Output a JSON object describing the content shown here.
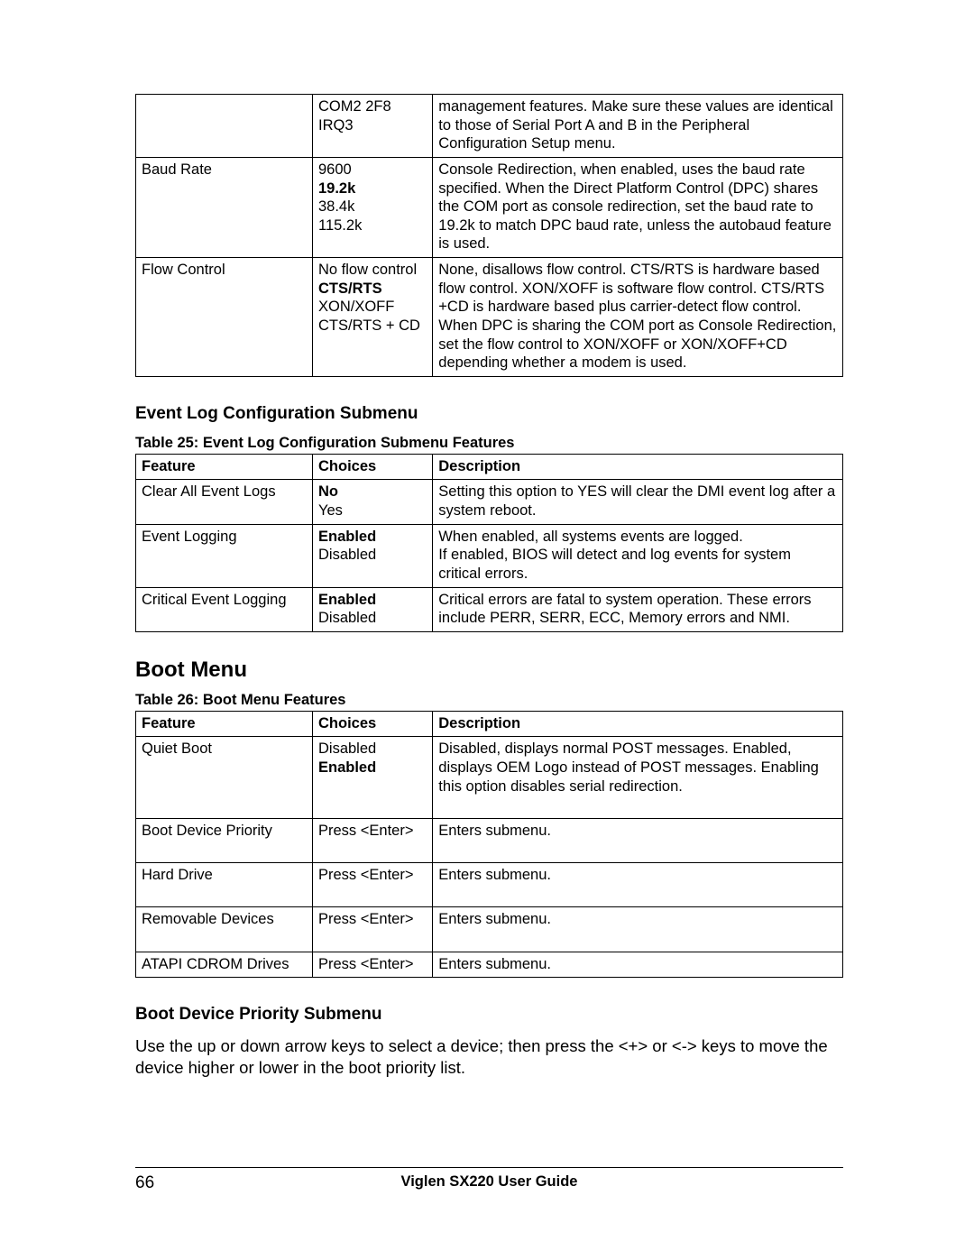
{
  "table24_tail": {
    "rows": [
      {
        "feature": "",
        "choices": [
          {
            "t": "COM2 2F8 IRQ3",
            "b": false
          }
        ],
        "desc": "management features. Make sure these values are identical to those of Serial Port A and B in the Peripheral Configuration Setup menu."
      },
      {
        "feature": "Baud Rate",
        "choices": [
          {
            "t": "9600",
            "b": false
          },
          {
            "t": "19.2k",
            "b": true
          },
          {
            "t": "38.4k",
            "b": false
          },
          {
            "t": "115.2k",
            "b": false
          }
        ],
        "desc": "Console Redirection, when enabled, uses the baud rate specified. When the Direct Platform Control (DPC) shares the COM port as console redirection, set the baud rate to 19.2k to match DPC baud rate, unless the autobaud feature is used."
      },
      {
        "feature": "Flow Control",
        "choices": [
          {
            "t": "No flow control",
            "b": false
          },
          {
            "t": "CTS/RTS",
            "b": true
          },
          {
            "t": "XON/XOFF",
            "b": false
          },
          {
            "t": "CTS/RTS + CD",
            "b": false
          }
        ],
        "desc": "None, disallows flow control. CTS/RTS is hardware based flow control. XON/XOFF is software flow control. CTS/RTS +CD is hardware based plus carrier-detect flow control. When DPC is sharing the COM port as Console Redirection, set the flow control to XON/XOFF or XON/XOFF+CD depending whether a modem is used."
      }
    ]
  },
  "event_log": {
    "heading": "Event Log Configuration Submenu",
    "caption": "Table 25: Event Log Configuration Submenu Features",
    "headers": {
      "feature": "Feature",
      "choices": "Choices",
      "desc": "Description"
    },
    "rows": [
      {
        "feature": "Clear All Event Logs",
        "choices": [
          {
            "t": "No",
            "b": true
          },
          {
            "t": "Yes",
            "b": false
          }
        ],
        "desc": "Setting this option to YES will clear the DMI event log after a system reboot."
      },
      {
        "feature": "Event Logging",
        "choices": [
          {
            "t": "Enabled",
            "b": true
          },
          {
            "t": "Disabled",
            "b": false
          }
        ],
        "desc": "When enabled, all systems events are logged.\nIf enabled, BIOS will detect and log events for system critical errors."
      },
      {
        "feature": "Critical Event Logging",
        "choices": [
          {
            "t": "Enabled",
            "b": true
          },
          {
            "t": "Disabled",
            "b": false
          }
        ],
        "desc": "Critical errors are fatal to system operation. These errors include PERR, SERR, ECC, Memory errors and NMI."
      }
    ]
  },
  "boot_menu": {
    "heading": "Boot Menu",
    "caption": "Table 26: Boot Menu Features",
    "headers": {
      "feature": "Feature",
      "choices": "Choices",
      "desc": "Description"
    },
    "rows": [
      {
        "feature": "Quiet Boot",
        "choices": [
          {
            "t": "Disabled",
            "b": false
          },
          {
            "t": "Enabled",
            "b": true
          }
        ],
        "desc": "Disabled, displays normal POST messages. Enabled, displays OEM Logo instead of POST messages. Enabling this option disables serial redirection.",
        "extra_pad": true
      },
      {
        "feature": "Boot Device Priority",
        "choices": [
          {
            "t": "Press <Enter>",
            "b": false
          }
        ],
        "desc": "Enters submenu.",
        "extra_pad": true
      },
      {
        "feature": "Hard Drive",
        "choices": [
          {
            "t": "Press <Enter>",
            "b": false
          }
        ],
        "desc": "Enters submenu.",
        "extra_pad": true
      },
      {
        "feature": "Removable Devices",
        "choices": [
          {
            "t": "Press <Enter>",
            "b": false
          }
        ],
        "desc": "Enters submenu.",
        "extra_pad": true
      },
      {
        "feature": "ATAPI CDROM Drives",
        "choices": [
          {
            "t": "Press <Enter>",
            "b": false
          }
        ],
        "desc": "Enters submenu."
      }
    ]
  },
  "boot_priority": {
    "heading": "Boot Device Priority Submenu",
    "paragraph": "Use the up or down arrow keys to select a device; then press the <+> or <-> keys to move the device higher or lower in the boot priority list."
  },
  "footer": {
    "page": "66",
    "title": "Viglen SX220 User Guide"
  }
}
